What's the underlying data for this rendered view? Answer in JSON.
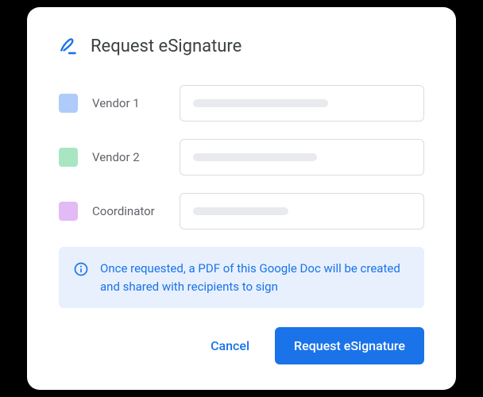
{
  "header": {
    "title": "Request eSignature"
  },
  "signers": [
    {
      "label": "Vendor 1",
      "swatch": "swatch-blue",
      "placeholderWidth": "170px"
    },
    {
      "label": "Vendor 2",
      "swatch": "swatch-green",
      "placeholderWidth": "156px"
    },
    {
      "label": "Coordinator",
      "swatch": "swatch-purple",
      "placeholderWidth": "120px"
    }
  ],
  "info": {
    "text": "Once requested, a PDF of this Google Doc will be created and shared with recipients to sign"
  },
  "actions": {
    "cancel": "Cancel",
    "primary": "Request eSignature"
  }
}
